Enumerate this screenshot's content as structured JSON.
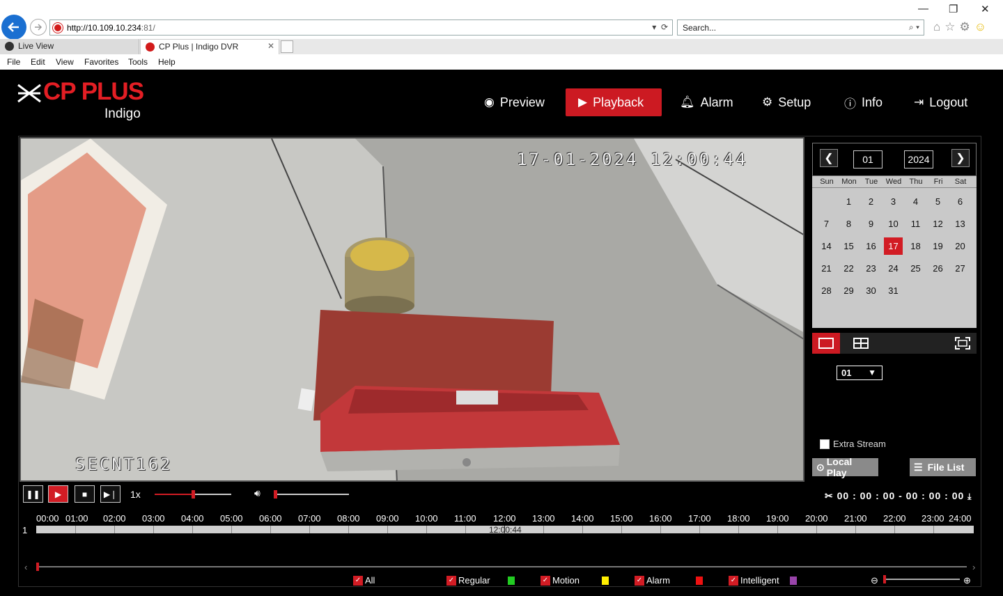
{
  "browser": {
    "url_host": "http://10.109.10.234",
    "url_rest": ":81/",
    "search_placeholder": "Search...",
    "tabs": [
      {
        "label": "Live View"
      },
      {
        "label": "CP Plus | Indigo DVR"
      }
    ],
    "menu": [
      "File",
      "Edit",
      "View",
      "Favorites",
      "Tools",
      "Help"
    ]
  },
  "app": {
    "brand": "CP PLUS",
    "sub_brand": "Indigo",
    "nav": [
      {
        "label": "Preview",
        "icon": "eye-icon"
      },
      {
        "label": "Playback",
        "icon": "play-circle-icon",
        "active": true
      },
      {
        "label": "Alarm",
        "icon": "bell-icon"
      },
      {
        "label": "Setup",
        "icon": "gear-icon"
      },
      {
        "label": "Info",
        "icon": "info-icon"
      },
      {
        "label": "Logout",
        "icon": "logout-icon"
      }
    ],
    "accent": "#cc1a22"
  },
  "video": {
    "timestamp": "17-01-2024 12:00:44",
    "camera_name": "SECNT162"
  },
  "calendar": {
    "month": "01",
    "year": "2024",
    "dows": [
      "Sun",
      "Mon",
      "Tue",
      "Wed",
      "Thu",
      "Fri",
      "Sat"
    ],
    "days": [
      "1",
      "2",
      "3",
      "4",
      "5",
      "6",
      "7",
      "8",
      "9",
      "10",
      "11",
      "12",
      "13",
      "14",
      "15",
      "16",
      "17",
      "18",
      "19",
      "20",
      "21",
      "22",
      "23",
      "24",
      "25",
      "26",
      "27",
      "28",
      "29",
      "30",
      "31"
    ],
    "selected": "17"
  },
  "panel": {
    "channel": "01",
    "extra_stream_label": "Extra Stream",
    "local_play_label": "Local Play",
    "file_list_label": "File List"
  },
  "controls": {
    "speed": "1x",
    "playback_progress": 0.5,
    "volume": 0.0,
    "clip_time": "00 : 00 : 00 - 00 : 00 : 00"
  },
  "timeline": {
    "hours": [
      "00:00",
      "01:00",
      "02:00",
      "03:00",
      "04:00",
      "05:00",
      "06:00",
      "07:00",
      "08:00",
      "09:00",
      "10:00",
      "11:00",
      "12:00",
      "13:00",
      "14:00",
      "15:00",
      "16:00",
      "17:00",
      "18:00",
      "19:00",
      "20:00",
      "21:00",
      "22:00",
      "23:00",
      "24:00"
    ],
    "row_number": "1",
    "cursor_time": "12:00:44"
  },
  "legend": [
    {
      "label": "All",
      "checked": true,
      "color": ""
    },
    {
      "label": "Regular",
      "checked": true,
      "color": "#22cc22"
    },
    {
      "label": "Motion",
      "checked": true,
      "color": "#ffee00"
    },
    {
      "label": "Alarm",
      "checked": true,
      "color": "#ee1111"
    },
    {
      "label": "Intelligent",
      "checked": true,
      "color": "#9944aa"
    }
  ]
}
